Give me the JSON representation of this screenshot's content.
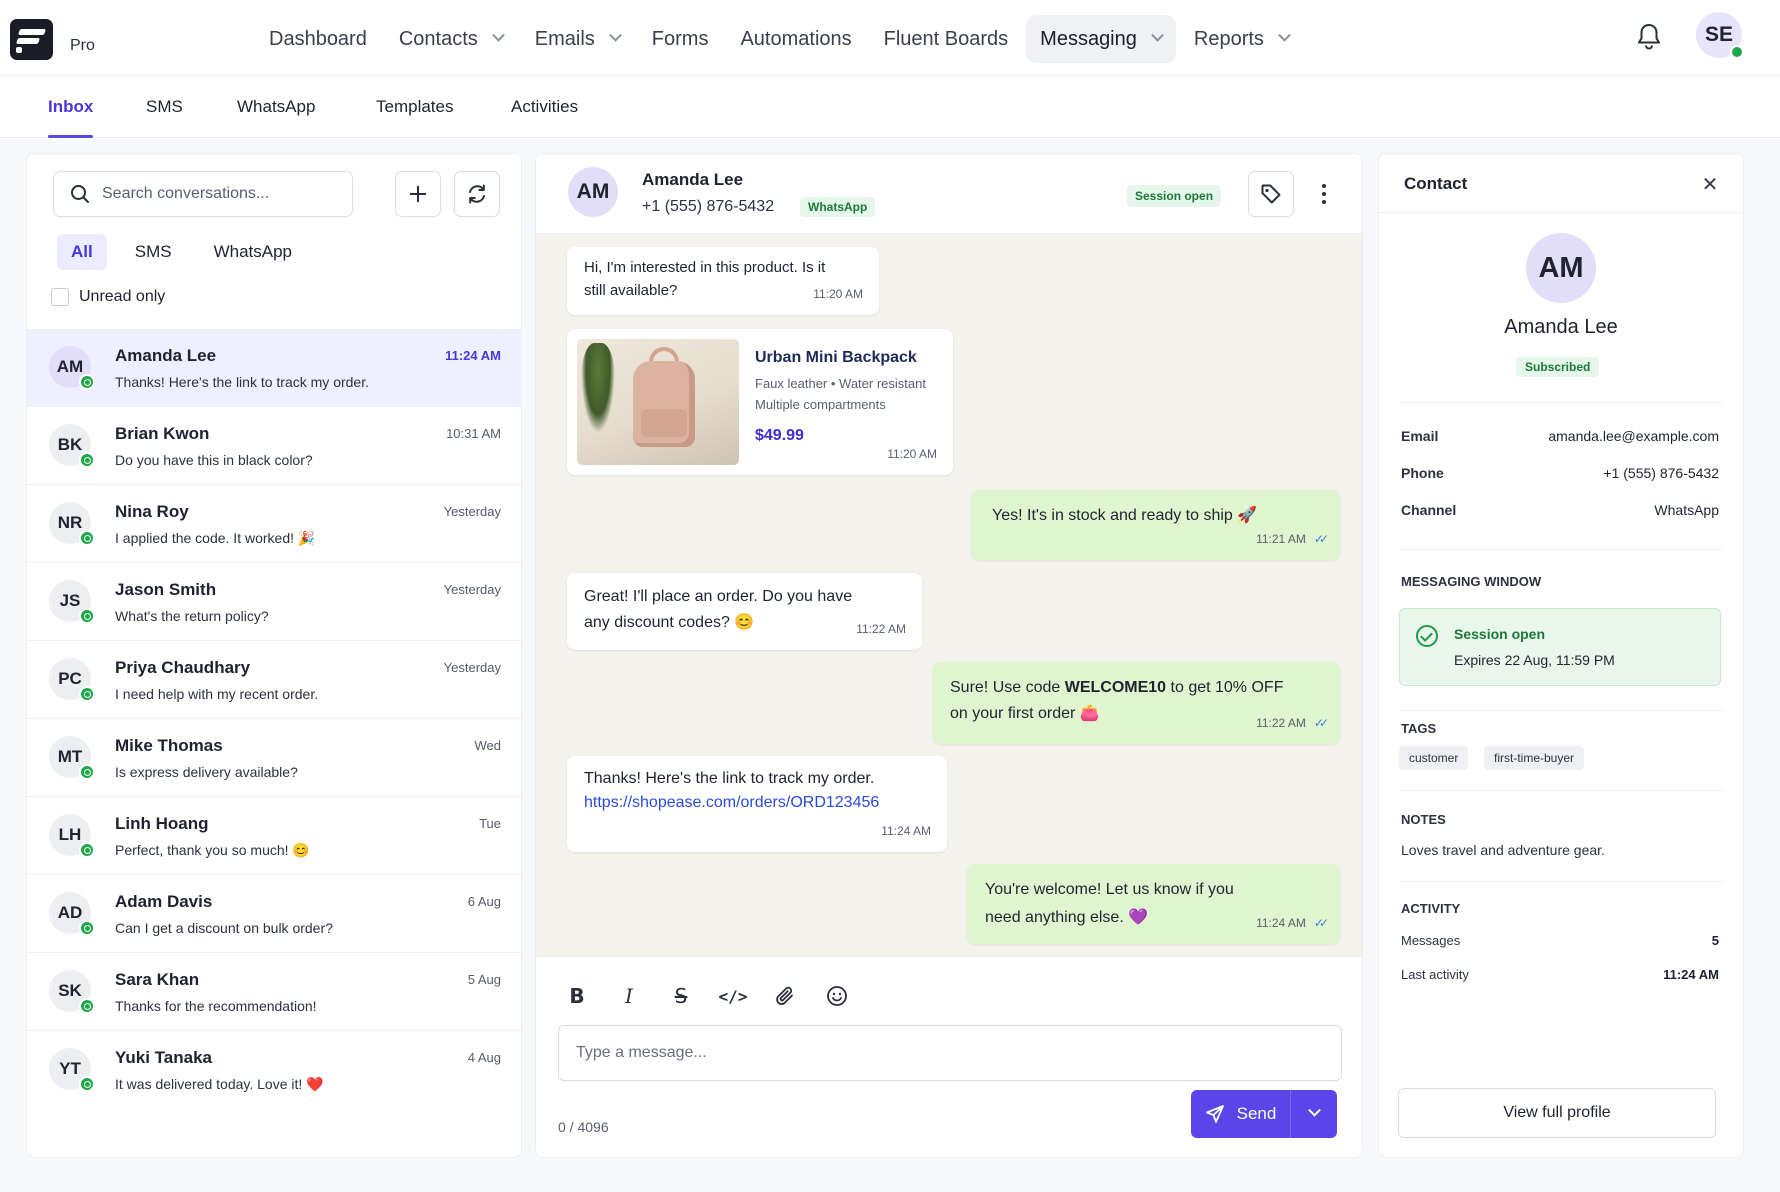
{
  "app": {
    "product_tier": "Pro",
    "nav": [
      {
        "label": "Dashboard",
        "has_dropdown": false
      },
      {
        "label": "Contacts",
        "has_dropdown": true
      },
      {
        "label": "Emails",
        "has_dropdown": true
      },
      {
        "label": "Forms",
        "has_dropdown": false
      },
      {
        "label": "Automations",
        "has_dropdown": false
      },
      {
        "label": "Fluent Boards",
        "has_dropdown": false
      },
      {
        "label": "Messaging",
        "has_dropdown": true,
        "active": true
      },
      {
        "label": "Reports",
        "has_dropdown": true
      }
    ],
    "user_initials": "SE",
    "icons": {
      "notifications": "bell-icon",
      "logo": "app-logo-icon"
    }
  },
  "subtabs": [
    "Inbox",
    "SMS",
    "WhatsApp",
    "Templates",
    "Activities"
  ],
  "colors": {
    "accent": "#5b45e8",
    "success": "#1fa84a",
    "outgoing_bubble": "#dff5cf",
    "chat_bg": "#f4f2ec"
  },
  "left": {
    "search_placeholder": "Search conversations...",
    "filters": [
      "All",
      "SMS",
      "WhatsApp"
    ],
    "unread_label": "Unread only",
    "conversations": [
      {
        "initials": "AM",
        "name": "Amanda Lee",
        "time": "11:24 AM",
        "preview": "Thanks! Here's the link to track my order."
      },
      {
        "initials": "BK",
        "name": "Brian Kwon",
        "time": "10:31 AM",
        "preview": "Do you have this in black color?"
      },
      {
        "initials": "NR",
        "name": "Nina Roy",
        "time": "Yesterday",
        "preview": "I applied the code. It worked! 🎉"
      },
      {
        "initials": "JS",
        "name": "Jason Smith",
        "time": "Yesterday",
        "preview": "What's the return policy?"
      },
      {
        "initials": "PC",
        "name": "Priya Chaudhary",
        "time": "Yesterday",
        "preview": "I need help with my recent order."
      },
      {
        "initials": "MT",
        "name": "Mike Thomas",
        "time": "Wed",
        "preview": "Is express delivery available?"
      },
      {
        "initials": "LH",
        "name": "Linh Hoang",
        "time": "Tue",
        "preview": "Perfect, thank you so much! 😊"
      },
      {
        "initials": "AD",
        "name": "Adam Davis",
        "time": "6 Aug",
        "preview": "Can I get a discount on bulk order?"
      },
      {
        "initials": "SK",
        "name": "Sara Khan",
        "time": "5 Aug",
        "preview": "Thanks for the recommendation!"
      },
      {
        "initials": "YT",
        "name": "Yuki Tanaka",
        "time": "4 Aug",
        "preview": "It was delivered today. Love it! ❤️"
      }
    ]
  },
  "chat": {
    "contact_initials": "AM",
    "contact_name": "Amanda Lee",
    "contact_phone": "+1 (555) 876-5432",
    "channel_badge": "WhatsApp",
    "session_badge": "Session open",
    "messages": {
      "m1": {
        "line1": "Hi, I'm interested in this product. Is it",
        "line2": "still available?",
        "time": "11:20 AM"
      },
      "product": {
        "title": "Urban Mini Backpack",
        "features": "Faux leather • Water resistant",
        "features2": "Multiple compartments",
        "price": "$49.99",
        "time": "11:20 AM"
      },
      "m2": {
        "text": "Yes! It's in stock and ready to ship 🚀",
        "time": "11:21 AM"
      },
      "m3": {
        "line1": "Great! I'll place an order. Do you have",
        "line2": "any discount codes? 😊",
        "time": "11:22 AM"
      },
      "m4": {
        "pre": "Sure! Use code ",
        "code": "WELCOME10",
        "post": " to get 10% OFF",
        "line2": "on your first order 👛",
        "time": "11:22 AM"
      },
      "m5": {
        "line1": "Thanks! Here's the link to track my order.",
        "link": "https://shopease.com/orders/ORD123456",
        "time": "11:24 AM"
      },
      "m6": {
        "line1": "You're welcome! Let us know if you",
        "line2": "need anything else. 💜",
        "time": "11:24 AM"
      }
    },
    "composer": {
      "placeholder": "Type a message...",
      "counter": "0 / 4096",
      "send_label": "Send"
    }
  },
  "contact_panel": {
    "title": "Contact",
    "initials": "AM",
    "name": "Amanda Lee",
    "status": "Subscribed",
    "fields": [
      {
        "key": "Email",
        "value": "amanda.lee@example.com"
      },
      {
        "key": "Phone",
        "value": "+1 (555) 876-5432"
      },
      {
        "key": "Channel",
        "value": "WhatsApp"
      }
    ],
    "messaging_window_label": "MESSAGING WINDOW",
    "session_status": "Session open",
    "session_expires": "Expires 22 Aug, 11:59 PM",
    "tags_label": "TAGS",
    "tags": [
      "customer",
      "first-time-buyer"
    ],
    "notes_label": "NOTES",
    "notes": "Loves travel and adventure gear.",
    "activity_label": "ACTIVITY",
    "activity": [
      {
        "key": "Messages",
        "value": "5"
      },
      {
        "key": "Last activity",
        "value": "11:24 AM"
      }
    ],
    "view_profile_label": "View full profile"
  }
}
